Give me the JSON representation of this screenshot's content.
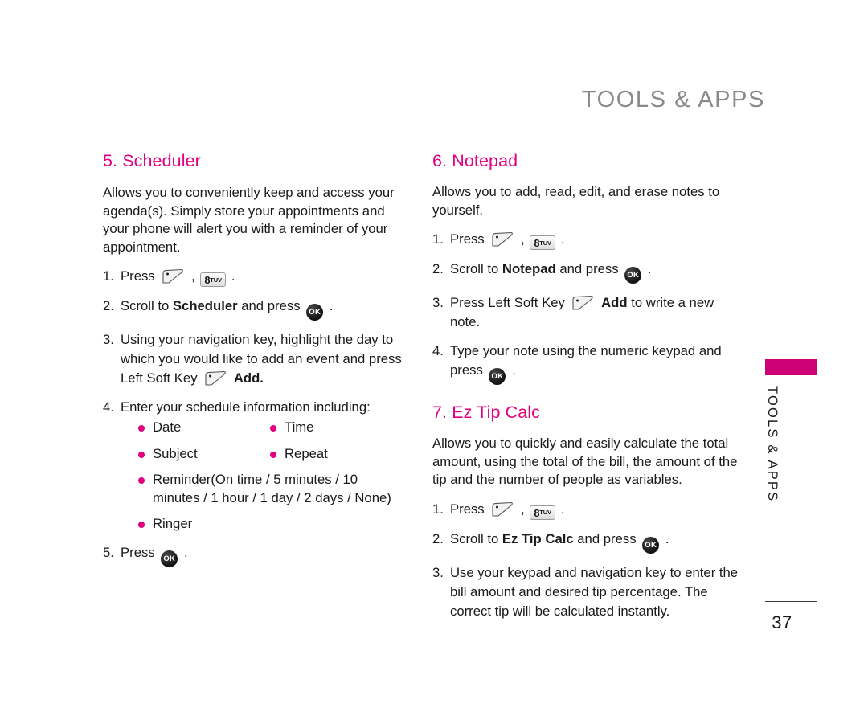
{
  "running_head": "TOOLS & APPS",
  "colors": {
    "heading_pink": "#e2007f",
    "tab_magenta": "#cc0077",
    "bullet_pink": "#e2007f",
    "running_head_gray": "#8a8a8a",
    "body_text": "#1a1a1a"
  },
  "icons": {
    "softkey": "left-soft-key-icon",
    "key8": {
      "number": "8",
      "letters": "TUV"
    },
    "ok": "OK"
  },
  "left_column": {
    "section": {
      "title": "5. Scheduler",
      "intro": "Allows you to conveniently keep and access your agenda(s). Simply store your appointments and your phone will alert you with a reminder of your appointment.",
      "steps": {
        "s1_num": "1.",
        "s1_a": "Press",
        "s1_comma": ",",
        "s1_end": ".",
        "s2_num": "2.",
        "s2_a": "Scroll to",
        "s2_bold": "Scheduler",
        "s2_b": "and press",
        "s2_end": ".",
        "s3_num": "3.",
        "s3_a": "Using your navigation key, highlight the day to which you would like to add an event and press Left Soft Key",
        "s3_bold": "Add.",
        "s4_num": "4.",
        "s4_a": "Enter your schedule information including:",
        "s5_num": "5.",
        "s5_a": "Press",
        "s5_end": "."
      },
      "bullets": [
        {
          "left": "Date",
          "right": "Time"
        },
        {
          "left": "Subject",
          "right": "Repeat"
        }
      ],
      "bullet_reminder": "Reminder(On time / 5 minutes / 10 minutes / 1 hour / 1 day / 2 days / None)",
      "bullet_ringer": "Ringer"
    }
  },
  "right_column": {
    "notepad": {
      "title": "6. Notepad",
      "intro": "Allows you to add, read, edit, and erase notes to yourself.",
      "steps": {
        "s1_num": "1.",
        "s1_a": "Press",
        "s1_comma": ",",
        "s1_end": ".",
        "s2_num": "2.",
        "s2_a": "Scroll to",
        "s2_bold": "Notepad",
        "s2_b": "and press",
        "s2_end": ".",
        "s3_num": "3.",
        "s3_a": "Press Left Soft Key",
        "s3_bold": "Add",
        "s3_b": "to write a new note.",
        "s4_num": "4.",
        "s4_a": "Type your note using the numeric keypad and press",
        "s4_end": "."
      }
    },
    "eztip": {
      "title": "7. Ez Tip Calc",
      "intro": "Allows you to quickly and easily calculate the total amount, using the total of the bill, the amount of the tip and the number of people as variables.",
      "steps": {
        "s1_num": "1.",
        "s1_a": "Press",
        "s1_comma": ",",
        "s1_end": ".",
        "s2_num": "2.",
        "s2_a": "Scroll to",
        "s2_bold": "Ez Tip Calc",
        "s2_b": "and press",
        "s2_end": ".",
        "s3_num": "3.",
        "s3_a": "Use your keypad and navigation key to enter the bill amount and desired tip percentage. The correct tip will be calculated instantly."
      }
    }
  },
  "thumb_tab": {
    "label": "TOOLS & APPS"
  },
  "footer": {
    "page_number": "37"
  }
}
